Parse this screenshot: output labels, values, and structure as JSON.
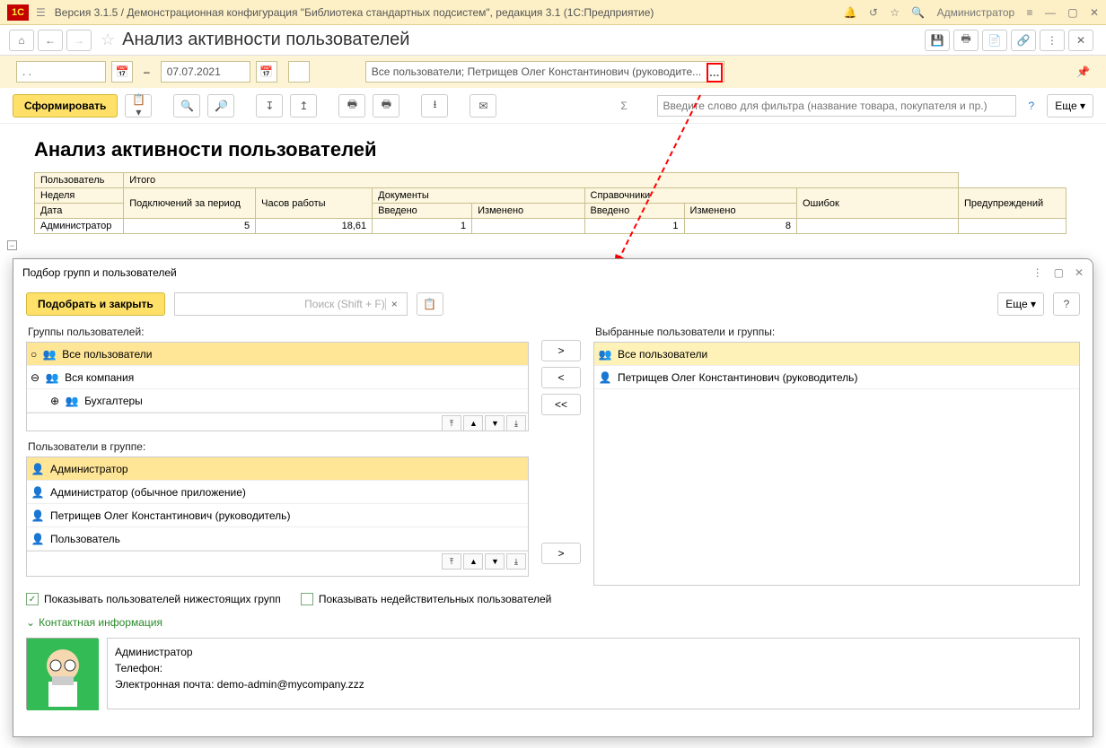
{
  "titlebar": {
    "version_title": "Версия 3.1.5 / Демонстрационная конфигурация \"Библиотека стандартных подсистем\", редакция 3.1  (1С:Предприятие)",
    "admin": "Администратор"
  },
  "page": {
    "title": "Анализ активности пользователей"
  },
  "filter": {
    "date_from": ".  .",
    "date_to": "07.07.2021",
    "users": "Все пользователи; Петрищев Олег Константинович (руководите..."
  },
  "actions": {
    "generate": "Сформировать",
    "search_placeholder": "Введите слово для фильтра (название товара, покупателя и пр.)",
    "more": "Еще"
  },
  "report": {
    "title": "Анализ активности пользователей",
    "h_user": "Пользователь",
    "h_total": "Итого",
    "h_week": "Неделя",
    "h_conn": "Подключений за период",
    "h_hours": "Часов работы",
    "h_docs": "Документы",
    "h_refs": "Справочники",
    "h_err": "Ошибок",
    "h_warn": "Предупреждений",
    "h_date": "Дата",
    "h_ent": "Введено",
    "h_chg": "Изменено",
    "row1_user": "Администратор",
    "row1_conn": "5",
    "row1_hours": "18,61",
    "row1_docs_ent": "1",
    "row1_refs_ent": "1",
    "row1_refs_chg": "8"
  },
  "dialog": {
    "title": "Подбор групп и пользователей",
    "pick_close": "Подобрать и закрыть",
    "search_placeholder": "Поиск (Shift + F)",
    "more": "Еще",
    "groups_label": "Группы пользователей:",
    "users_label": "Пользователи в группе:",
    "selected_label": "Выбранные пользователи и группы:",
    "groups": [
      {
        "name": "Все пользователи",
        "sel": true
      },
      {
        "name": "Вся компания",
        "sel": false
      },
      {
        "name": "Бухгалтеры",
        "sel": false,
        "indent": true
      }
    ],
    "users": [
      {
        "name": "Администратор",
        "sel": true
      },
      {
        "name": "Администратор (обычное приложение)"
      },
      {
        "name": "Петрищев Олег Константинович (руководитель)"
      },
      {
        "name": "Пользователь"
      }
    ],
    "selected": [
      {
        "name": "Все пользователи",
        "icon": "group"
      },
      {
        "name": "Петрищев Олег Константинович (руководитель)",
        "icon": "user"
      }
    ],
    "chk1": "Показывать пользователей нижестоящих групп",
    "chk2": "Показывать недействительных пользователей",
    "contact_toggle": "Контактная информация",
    "contact": {
      "name": "Администратор",
      "phone": "Телефон:",
      "email_label": "Электронная почта:",
      "email": "demo-admin@mycompany.zzz"
    }
  }
}
